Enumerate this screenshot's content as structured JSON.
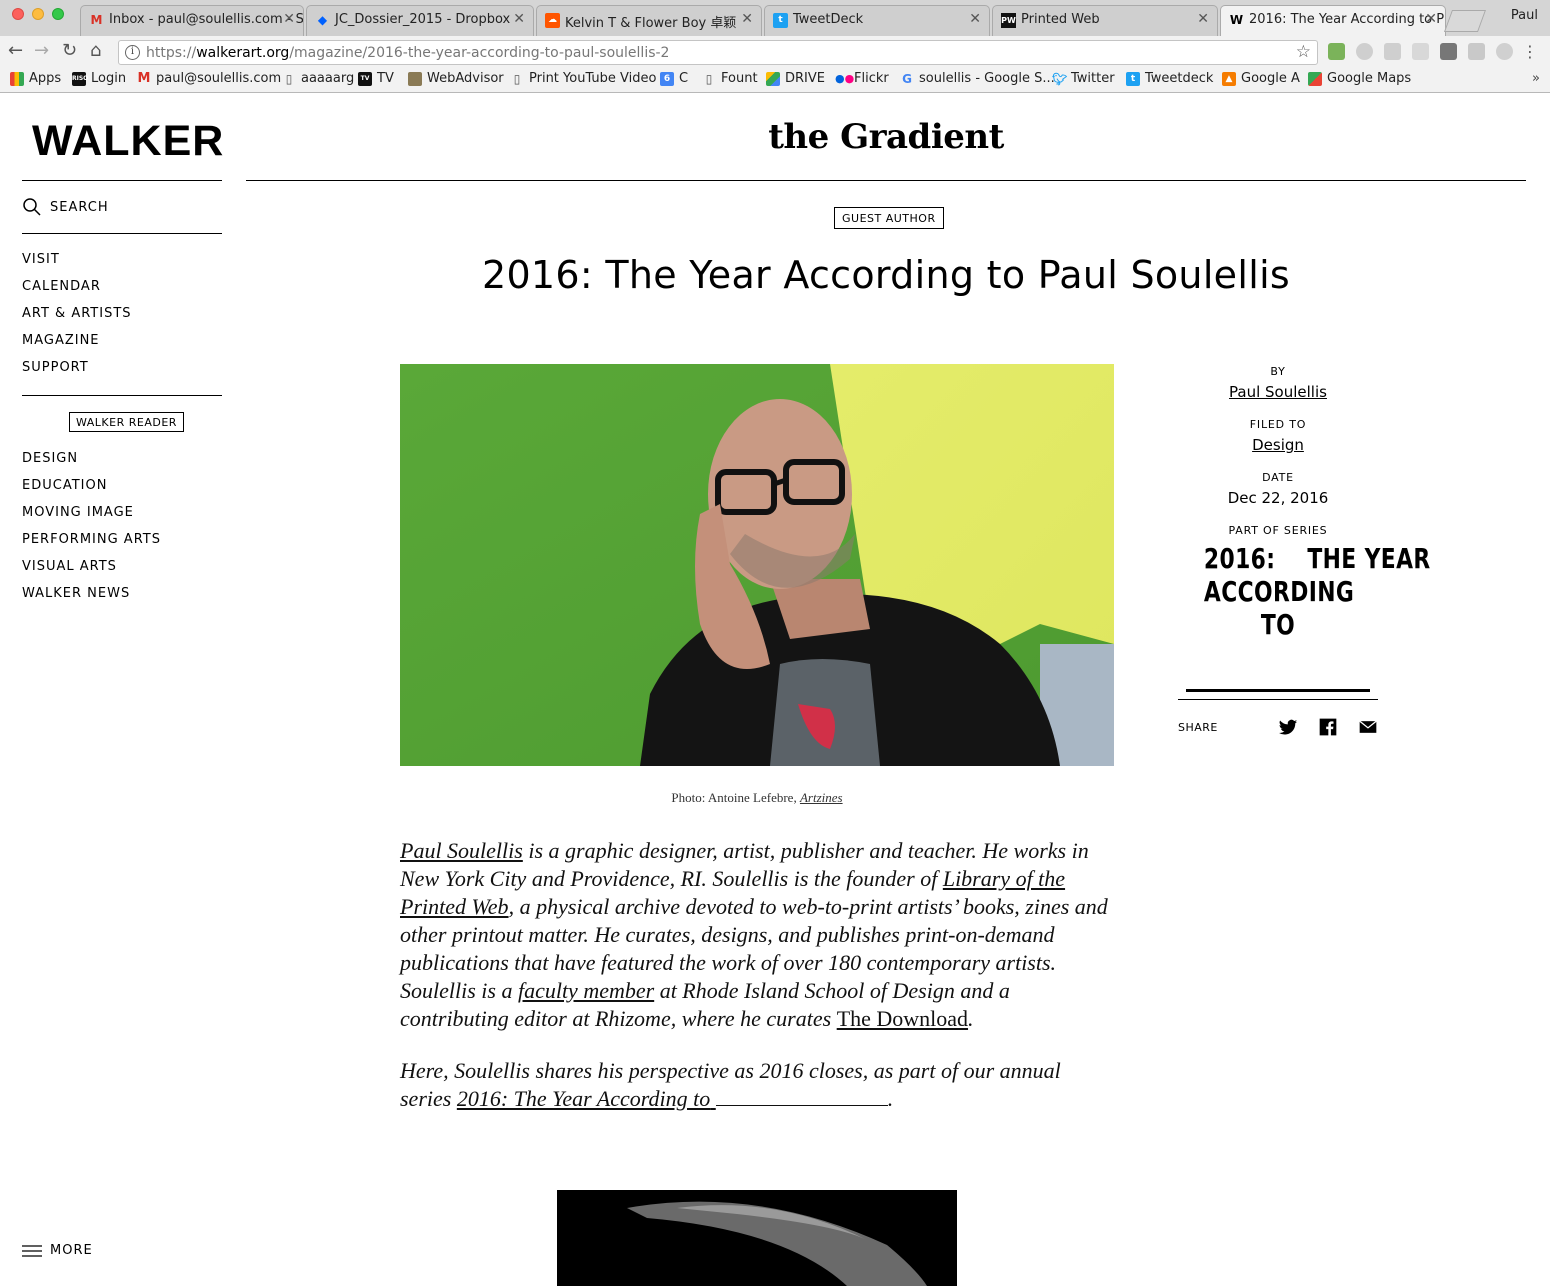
{
  "browser": {
    "tabs": [
      {
        "title": "Inbox - paul@soulellis.com - S",
        "icon": "gmail-icon",
        "active": false
      },
      {
        "title": "JC_Dossier_2015 - Dropbox",
        "icon": "dropbox-icon",
        "active": false
      },
      {
        "title": "Kelvin T & Flower Boy 卓颖",
        "icon": "soundcloud-icon",
        "active": false
      },
      {
        "title": "TweetDeck",
        "icon": "tweetdeck-icon",
        "active": false
      },
      {
        "title": "Printed Web",
        "icon": "printed-web-icon",
        "active": false
      },
      {
        "title": "2016: The Year According to P",
        "icon": "walker-icon",
        "active": true
      }
    ],
    "profile_name": "Paul",
    "url": {
      "scheme": "https://",
      "host": "walkerart.org",
      "path": "/magazine/2016-the-year-according-to-paul-soulellis-2"
    },
    "bookmarks": [
      {
        "label": "Apps",
        "icon": "apps-grid-icon"
      },
      {
        "label": "Login",
        "icon": "riso-icon"
      },
      {
        "label": "paul@soulellis.com",
        "icon": "gmail-icon"
      },
      {
        "label": "aaaaarg",
        "icon": "page-icon"
      },
      {
        "label": "TV",
        "icon": "tv-icon"
      },
      {
        "label": "WebAdvisor",
        "icon": "webadvisor-icon"
      },
      {
        "label": "Print YouTube Video",
        "icon": "page-icon"
      },
      {
        "label": "C",
        "icon": "calendar-icon"
      },
      {
        "label": "Fount",
        "icon": "page-icon"
      },
      {
        "label": "DRIVE",
        "icon": "drive-icon"
      },
      {
        "label": "Flickr",
        "icon": "flickr-icon"
      },
      {
        "label": "soulellis - Google S...",
        "icon": "google-icon"
      },
      {
        "label": "Twitter",
        "icon": "twitter-icon"
      },
      {
        "label": "Tweetdeck",
        "icon": "tweetdeck-icon"
      },
      {
        "label": "Google A",
        "icon": "analytics-icon"
      },
      {
        "label": "Google Maps",
        "icon": "maps-icon"
      }
    ],
    "bookmarks_overflow": "»"
  },
  "site": {
    "logo": "WALKER",
    "search_label": "SEARCH",
    "main_nav": [
      "VISIT",
      "CALENDAR",
      "ART & ARTISTS",
      "MAGAZINE",
      "SUPPORT"
    ],
    "reader_badge": "WALKER READER",
    "reader_nav": [
      "DESIGN",
      "EDUCATION",
      "MOVING IMAGE",
      "PERFORMING ARTS",
      "VISUAL ARTS",
      "WALKER NEWS"
    ],
    "more_label": "MORE",
    "section_logo": "the Gradient"
  },
  "article": {
    "badge": "GUEST AUTHOR",
    "title": "2016: The Year According to Paul Soulellis",
    "caption_prefix": "Photo: Antoine Lefebre, ",
    "caption_link": "Artzines",
    "meta": {
      "by_label": "BY",
      "author": "Paul Soulellis",
      "filed_label": "FILED TO",
      "filed": "Design",
      "date_label": "DATE",
      "date": "Dec 22, 2016",
      "series_label": "PART OF SERIES",
      "series_logo_line1": "2016:    THE YEAR",
      "series_logo_line2": "ACCORDING TO",
      "share_label": "SHARE"
    },
    "p1": {
      "l_author": "Paul Soulellis",
      "t1": " is a graphic designer, artist, publisher and teacher. He works in New York City and Providence, RI. Soulellis is the founder of ",
      "l_library": "Library of the Printed Web",
      "t2": ", a physical archive devoted to web-to-print artists’ books, zines and other printout matter. He curates, designs, and publishes print-on-demand publications that have featured the work of over 180 contemporary artists. Soulellis is a ",
      "l_faculty": "faculty member",
      "t3": " at Rhode Island School of Design and a contributing editor at Rhizome, where he curates ",
      "l_download": "The Download",
      "t4": "."
    },
    "p2": {
      "t1": "Here, Soulellis shares his perspective as 2016 closes, as part of our annual series ",
      "l_series": "2016: The Year According to",
      "t2": "."
    }
  }
}
